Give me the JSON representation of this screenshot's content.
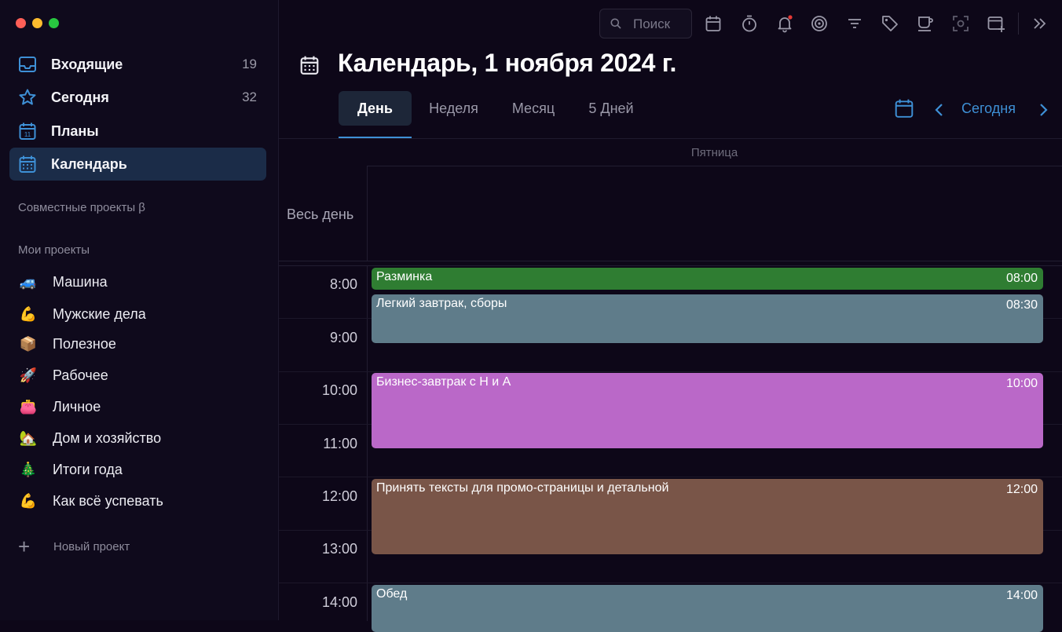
{
  "sidebar": {
    "nav": [
      {
        "label": "Входящие",
        "count": "19"
      },
      {
        "label": "Сегодня",
        "count": "32"
      },
      {
        "label": "Планы",
        "count": ""
      },
      {
        "label": "Календарь",
        "count": ""
      }
    ],
    "shared_title": "Совместные проекты β",
    "my_projects_title": "Мои проекты",
    "projects": [
      {
        "emoji": "🚙",
        "label": "Машина"
      },
      {
        "emoji": "💪",
        "label": "Мужские дела"
      },
      {
        "emoji": "📦",
        "label": "Полезное"
      },
      {
        "emoji": "🚀",
        "label": "Рабочее"
      },
      {
        "emoji": "👛",
        "label": "Личное"
      },
      {
        "emoji": "🏡",
        "label": "Дом и хозяйство"
      },
      {
        "emoji": "🎄",
        "label": "Итоги года"
      },
      {
        "emoji": "💪",
        "label": "Как всё успевать"
      }
    ],
    "new_project_label": "Новый проект"
  },
  "toolbar": {
    "search_placeholder": "Поиск"
  },
  "header": {
    "title": "Календарь, 1 ноября 2024 г."
  },
  "tabs": [
    {
      "label": "День"
    },
    {
      "label": "Неделя"
    },
    {
      "label": "Месяц"
    },
    {
      "label": "5 Дней"
    }
  ],
  "nav": {
    "today_label": "Сегодня"
  },
  "day": {
    "weekday": "Пятница",
    "all_day_label": "Весь день",
    "hours": [
      "8:00",
      "9:00",
      "10:00",
      "11:00",
      "12:00",
      "13:00",
      "14:00"
    ],
    "events": [
      {
        "title": "Разминка",
        "time": "08:00",
        "color": "#2f7d32"
      },
      {
        "title": "Легкий завтрак, сборы",
        "time": "08:30",
        "color": "#5f7c8a"
      },
      {
        "title": "Бизнес-завтрак с Н и А",
        "time": "10:00",
        "color": "#ba68c8"
      },
      {
        "title": "Принять тексты для промо-страницы и детальной",
        "time": "12:00",
        "color": "#795548"
      },
      {
        "title": "Обед",
        "time": "14:00",
        "color": "#5f7c8a"
      }
    ]
  },
  "colors": {
    "accent": "#3e90d6",
    "background": "#0d0718",
    "sidebar_active": "#1b2c48",
    "notification_dot": "#e53935"
  }
}
